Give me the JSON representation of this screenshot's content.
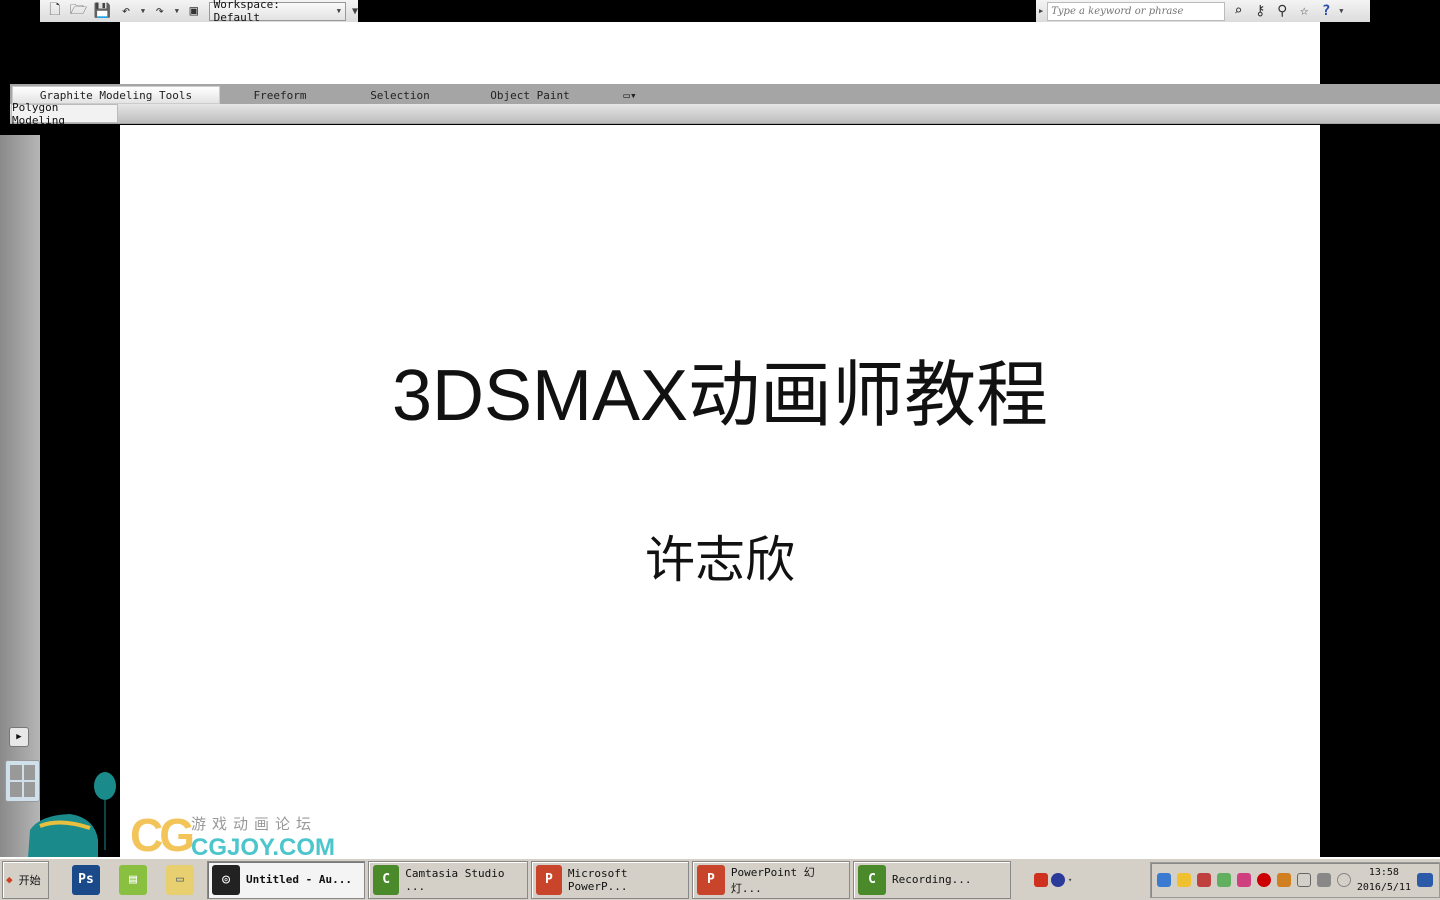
{
  "toolbar": {
    "workspace_label": "Workspace: Default",
    "icons": [
      "new-file-icon",
      "open-folder-icon",
      "save-icon",
      "undo-icon",
      "redo-icon",
      "project-folder-icon"
    ]
  },
  "search": {
    "placeholder": "Type a keyword or phrase",
    "icons": [
      "binoculars-icon",
      "key-icon",
      "satellite-icon",
      "star-icon",
      "help-icon"
    ]
  },
  "ribbon": {
    "tabs": [
      "Graphite Modeling Tools",
      "Freeform",
      "Selection",
      "Object Paint"
    ],
    "panel": "Polygon Modeling"
  },
  "slide": {
    "title": "3DSMAX动画师教程",
    "author": "许志欣"
  },
  "watermark": {
    "brand": "CGJOY.COM",
    "tagline": "游戏动画论坛"
  },
  "taskbar": {
    "start": "开始",
    "quick_launch": [
      "Ps"
    ],
    "windows": [
      {
        "label": "Untitled - Au...",
        "active": true,
        "color": "#222222"
      },
      {
        "label": "Camtasia Studio ...",
        "color": "#4a8a2a"
      },
      {
        "label": "Microsoft PowerP...",
        "color": "#c8442a"
      },
      {
        "label": "PowerPoint 幻灯...",
        "color": "#c8442a"
      },
      {
        "label": "Recording...",
        "color": "#4a8a2a"
      }
    ],
    "clock_time": "13:58",
    "clock_date": "2016/5/11"
  }
}
